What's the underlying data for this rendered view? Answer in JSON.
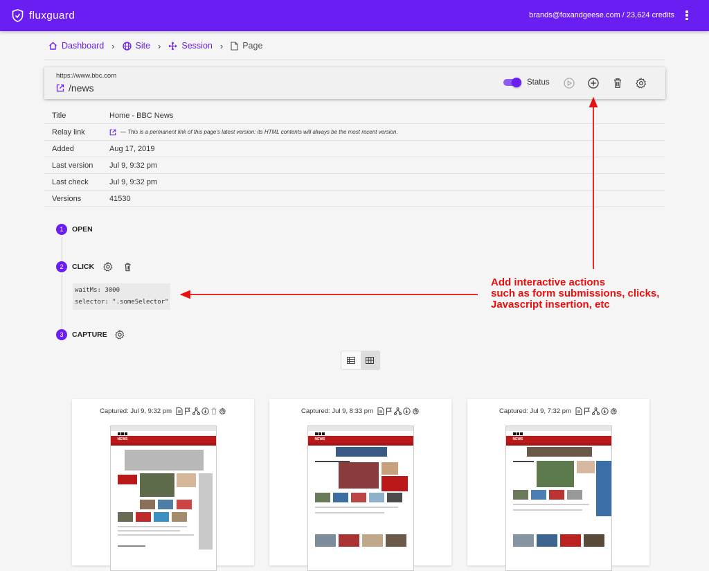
{
  "header": {
    "brand": "fluxguard",
    "account": "brands@foxandgeese.com / 23,624 credits"
  },
  "breadcrumb": {
    "dashboard": "Dashboard",
    "site": "Site",
    "session": "Session",
    "page": "Page"
  },
  "page": {
    "url": "https://www.bbc.com",
    "path": "/news",
    "status_label": "Status",
    "status_on": true
  },
  "meta": {
    "title_label": "Title",
    "title_value": "Home - BBC News",
    "relay_label": "Relay link",
    "relay_value": "— This is a permanent link of this page's latest version: its HTML contents will always be the most recent version.",
    "added_label": "Added",
    "added_value": "Aug 17, 2019",
    "lastversion_label": "Last version",
    "lastversion_value": "Jul 9, 9:32 pm",
    "lastcheck_label": "Last check",
    "lastcheck_value": "Jul 9, 9:32 pm",
    "versions_label": "Versions",
    "versions_value": "41530"
  },
  "steps": [
    {
      "num": "1",
      "label": "OPEN"
    },
    {
      "num": "2",
      "label": "CLICK",
      "code": [
        "waitMs: 3000",
        "selector: \".someSelector\""
      ]
    },
    {
      "num": "3",
      "label": "CAPTURE"
    }
  ],
  "annotation": [
    "Add interactive actions",
    "such as form submissions, clicks,",
    "Javascript insertion, etc"
  ],
  "captures": [
    {
      "label": "Captured: Jul 9, 9:32 pm",
      "thumb_news": "NEWS"
    },
    {
      "label": "Captured: Jul 9, 8:33 pm",
      "thumb_news": "NEWS"
    },
    {
      "label": "Captured: Jul 9, 7:32 pm",
      "thumb_news": "NEWS"
    }
  ],
  "colors": {
    "brand": "#6a1ef2",
    "annotation": "#e8100e",
    "bbc_red": "#bb1919"
  },
  "view_mode": "grid"
}
